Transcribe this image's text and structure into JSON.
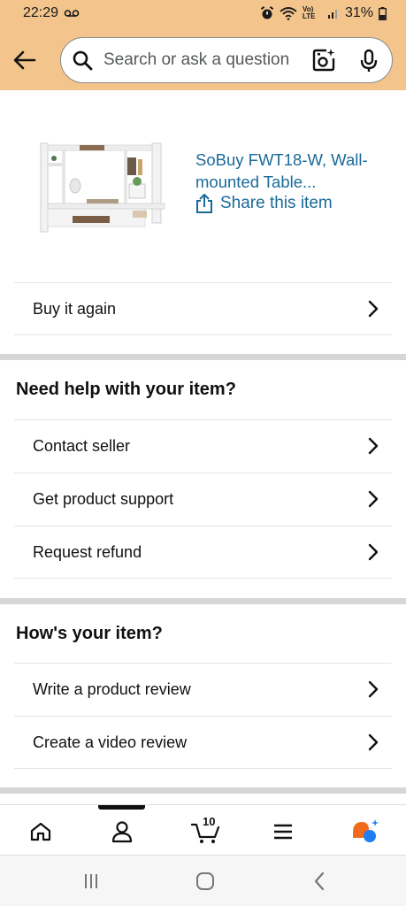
{
  "status_bar": {
    "time": "22:29",
    "battery": "31%",
    "network": "Vo) LTE"
  },
  "search": {
    "placeholder": "Search or ask a question"
  },
  "product": {
    "title": "SoBuy FWT18-W, Wall-mounted Table...",
    "share_label": "Share this item"
  },
  "buy_again": {
    "label": "Buy it again"
  },
  "help_section": {
    "heading": "Need help with your item?",
    "items": [
      {
        "label": "Contact seller"
      },
      {
        "label": "Get product support"
      },
      {
        "label": "Request refund"
      }
    ]
  },
  "review_section": {
    "heading": "How's your item?",
    "items": [
      {
        "label": "Write a product review"
      },
      {
        "label": "Create a video review"
      }
    ]
  },
  "bottom_nav": {
    "cart_count": "10",
    "active": "account"
  },
  "colors": {
    "header_bg": "#f3c48b",
    "link": "#1a6a99",
    "divider": "#d5d6d6",
    "ai_orange": "#f06a1c",
    "ai_blue": "#1f7ef2"
  }
}
